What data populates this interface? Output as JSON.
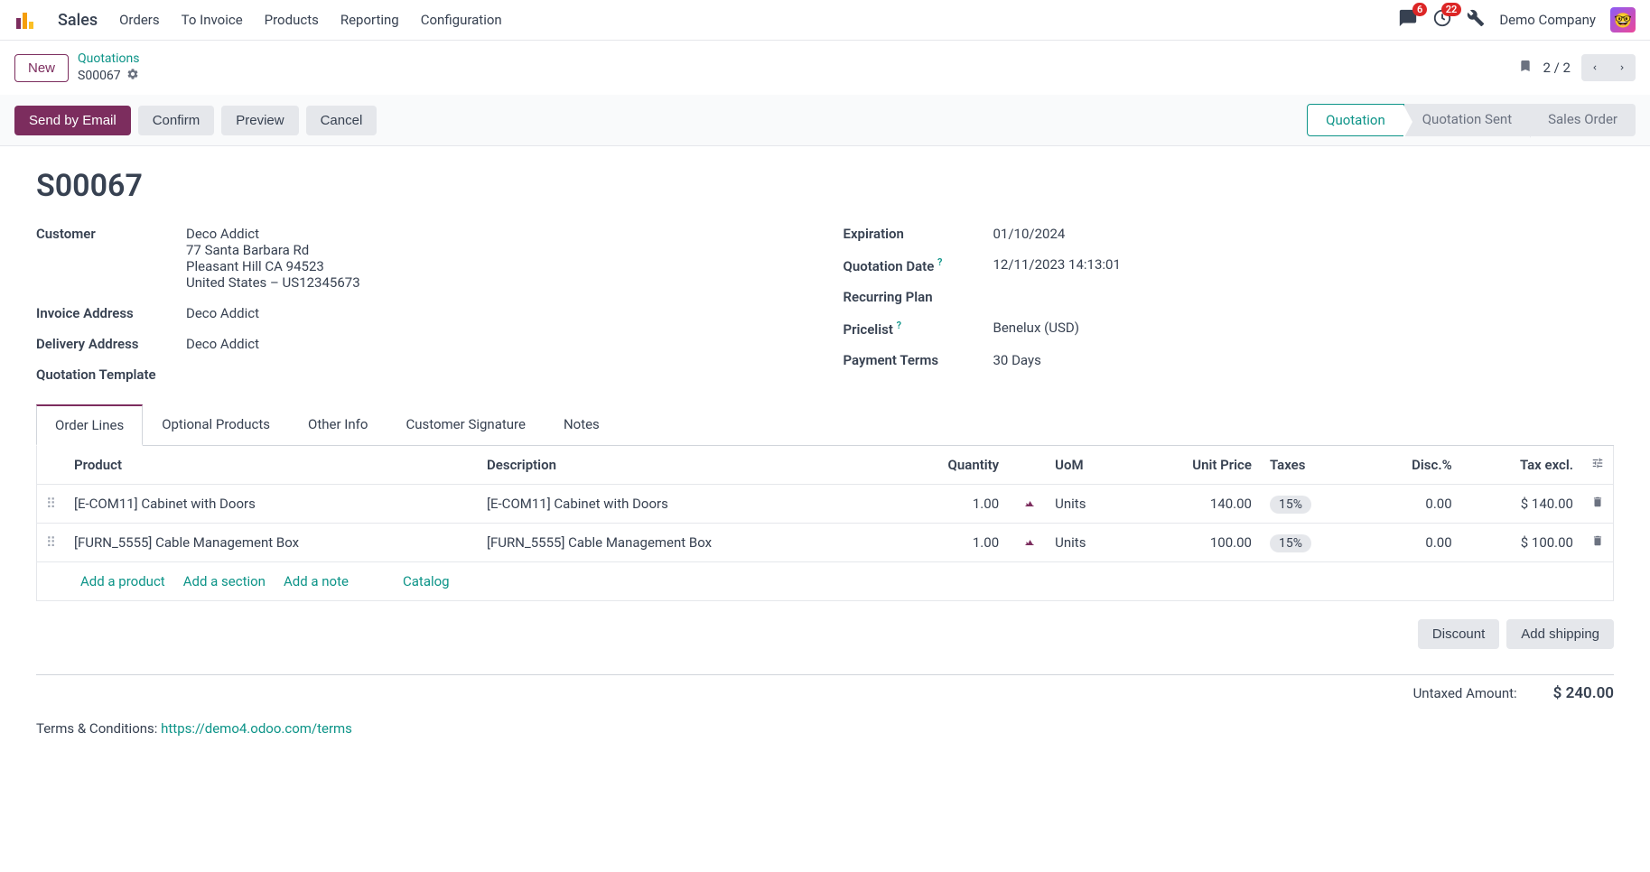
{
  "app": {
    "name": "Sales"
  },
  "nav": {
    "links": [
      "Orders",
      "To Invoice",
      "Products",
      "Reporting",
      "Configuration"
    ],
    "messages_badge": "6",
    "activities_badge": "22",
    "company": "Demo Company"
  },
  "breadcrumb": {
    "new_btn": "New",
    "parent": "Quotations",
    "current": "S00067",
    "pager": "2 / 2"
  },
  "actions": {
    "send_email": "Send by Email",
    "confirm": "Confirm",
    "preview": "Preview",
    "cancel": "Cancel"
  },
  "stages": [
    "Quotation",
    "Quotation Sent",
    "Sales Order"
  ],
  "doc": {
    "title": "S00067",
    "labels": {
      "customer": "Customer",
      "invoice_address": "Invoice Address",
      "delivery_address": "Delivery Address",
      "quotation_template": "Quotation Template",
      "expiration": "Expiration",
      "quotation_date": "Quotation Date",
      "recurring_plan": "Recurring Plan",
      "pricelist": "Pricelist",
      "payment_terms": "Payment Terms"
    },
    "customer": {
      "name": "Deco Addict",
      "street": "77 Santa Barbara Rd",
      "city": "Pleasant Hill CA 94523",
      "country": "United States – US12345673"
    },
    "invoice_address": "Deco Addict",
    "delivery_address": "Deco Addict",
    "expiration": "01/10/2024",
    "quotation_date": "12/11/2023 14:13:01",
    "pricelist": "Benelux (USD)",
    "payment_terms": "30 Days"
  },
  "tabs": [
    "Order Lines",
    "Optional Products",
    "Other Info",
    "Customer Signature",
    "Notes"
  ],
  "table": {
    "headers": {
      "product": "Product",
      "description": "Description",
      "quantity": "Quantity",
      "uom": "UoM",
      "unit_price": "Unit Price",
      "taxes": "Taxes",
      "disc": "Disc.%",
      "tax_excl": "Tax excl."
    },
    "rows": [
      {
        "product": "[E-COM11] Cabinet with Doors",
        "description": "[E-COM11] Cabinet with Doors",
        "quantity": "1.00",
        "uom": "Units",
        "unit_price": "140.00",
        "tax": "15%",
        "disc": "0.00",
        "tax_excl": "$ 140.00"
      },
      {
        "product": "[FURN_5555] Cable Management Box",
        "description": "[FURN_5555] Cable Management Box",
        "quantity": "1.00",
        "uom": "Units",
        "unit_price": "100.00",
        "tax": "15%",
        "disc": "0.00",
        "tax_excl": "$ 100.00"
      }
    ],
    "add": {
      "product": "Add a product",
      "section": "Add a section",
      "note": "Add a note",
      "catalog": "Catalog"
    }
  },
  "footer": {
    "discount": "Discount",
    "add_shipping": "Add shipping",
    "untaxed_label": "Untaxed Amount:",
    "untaxed_value": "$ 240.00",
    "terms_label": "Terms & Conditions: ",
    "terms_link": "https://demo4.odoo.com/terms"
  }
}
